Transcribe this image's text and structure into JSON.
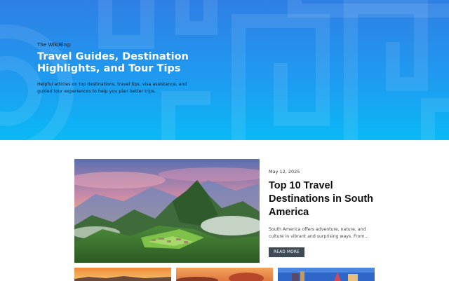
{
  "hero": {
    "kicker": "The WikiBlog:",
    "title": "Travel Guides, Destination Highlights, and Tour Tips",
    "description": "Helpful articles on top destinations, travel tips, visa assistance, and guided tour experiences to help you plan better trips."
  },
  "featured_post": {
    "date": "May 12, 2025",
    "title": "Top 10 Travel Destinations in South America",
    "excerpt": "South America offers adventure, nature, and culture in vibrant and surprising ways. From...",
    "button_label": "READ MORE"
  },
  "colors": {
    "hero_top": "#2f7fe4",
    "hero_bottom": "#0ab9f5",
    "button_bg": "#3d4a57"
  }
}
